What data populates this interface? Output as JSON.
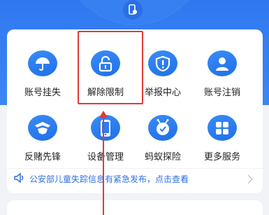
{
  "grid": {
    "items": [
      {
        "label": "账号挂失",
        "icon": "umbrella-icon"
      },
      {
        "label": "解除限制",
        "icon": "unlock-icon"
      },
      {
        "label": "举报中心",
        "icon": "report-shield-icon"
      },
      {
        "label": "账号注销",
        "icon": "user-icon"
      },
      {
        "label": "反赌先锋",
        "icon": "anti-gambling-icon"
      },
      {
        "label": "设备管理",
        "icon": "phone-icon"
      },
      {
        "label": "蚂蚁探险",
        "icon": "ant-icon"
      },
      {
        "label": "更多服务",
        "icon": "grid-more-icon"
      }
    ]
  },
  "notice": {
    "text": "公安部儿童失踪信息有紧急发布，点击查看",
    "icon": "megaphone-icon"
  },
  "colors": {
    "brand": "#1f6fe8",
    "annotation": "#e03a3a",
    "notice_text": "#2f6fe0"
  }
}
